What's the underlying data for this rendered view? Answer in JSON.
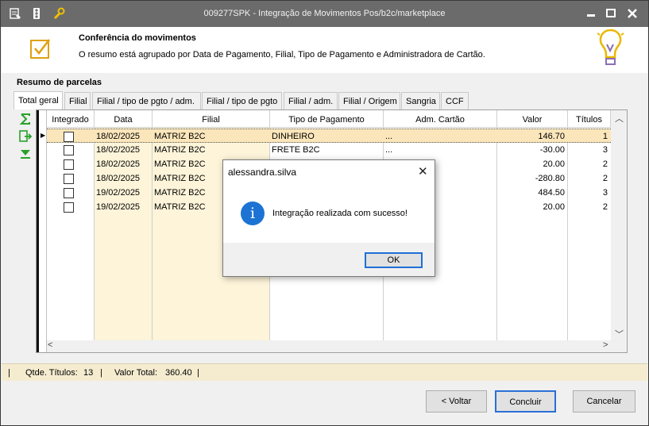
{
  "window": {
    "title": "009277SPK - Integração de Movimentos Pos/b2c/marketplace"
  },
  "header": {
    "title": "Conferência do movimentos",
    "subtitle": "O resumo está agrupado por Data de Pagamento, Filial, Tipo de Pagamento e Administradora de Cartão."
  },
  "section": {
    "title": "Resumo de parcelas"
  },
  "tabs": [
    {
      "label": "Total geral"
    },
    {
      "label": "Filial"
    },
    {
      "label": "Filial / tipo de pgto / adm."
    },
    {
      "label": "Filial / tipo de pgto"
    },
    {
      "label": "Filial / adm."
    },
    {
      "label": "Filial / Origem"
    },
    {
      "label": "Sangria"
    },
    {
      "label": "CCF"
    }
  ],
  "grid": {
    "columns": [
      "Integrado",
      "Data",
      "Filial",
      "Tipo de Pagamento",
      "Adm. Cartão",
      "Valor",
      "Títulos"
    ],
    "rows": [
      {
        "data": "18/02/2025",
        "filial": "MATRIZ B2C",
        "tipo": "DINHEIRO",
        "adm": "...",
        "valor": "146.70",
        "titulos": "1"
      },
      {
        "data": "18/02/2025",
        "filial": "MATRIZ B2C",
        "tipo": "FRETE B2C",
        "adm": "...",
        "valor": "-30.00",
        "titulos": "3"
      },
      {
        "data": "18/02/2025",
        "filial": "MATRIZ B2C",
        "tipo": "",
        "adm": "",
        "valor": "20.00",
        "titulos": "2"
      },
      {
        "data": "18/02/2025",
        "filial": "MATRIZ B2C",
        "tipo": "",
        "adm": "",
        "valor": "-280.80",
        "titulos": "2"
      },
      {
        "data": "19/02/2025",
        "filial": "MATRIZ B2C",
        "tipo": "",
        "adm": "",
        "valor": "484.50",
        "titulos": "3"
      },
      {
        "data": "19/02/2025",
        "filial": "MATRIZ B2C",
        "tipo": "",
        "adm": "",
        "valor": "20.00",
        "titulos": "2"
      }
    ]
  },
  "status": {
    "qtde_label": "Qtde. Títulos:",
    "qtde_value": "13",
    "total_label": "Valor Total:",
    "total_value": "360.40",
    "sep": "|"
  },
  "buttons": {
    "back": "< Voltar",
    "finish": "Concluir",
    "cancel": "Cancelar"
  },
  "dialog": {
    "title": "alessandra.silva",
    "message": "Integração realizada com sucesso!",
    "ok": "OK"
  },
  "colors": {
    "titlebar": "#6b6b6b",
    "selected_row": "#fbe6bb",
    "status_bar": "#f5ecd0",
    "info_icon": "#1c73d4",
    "accent": "#2a6fd6"
  }
}
